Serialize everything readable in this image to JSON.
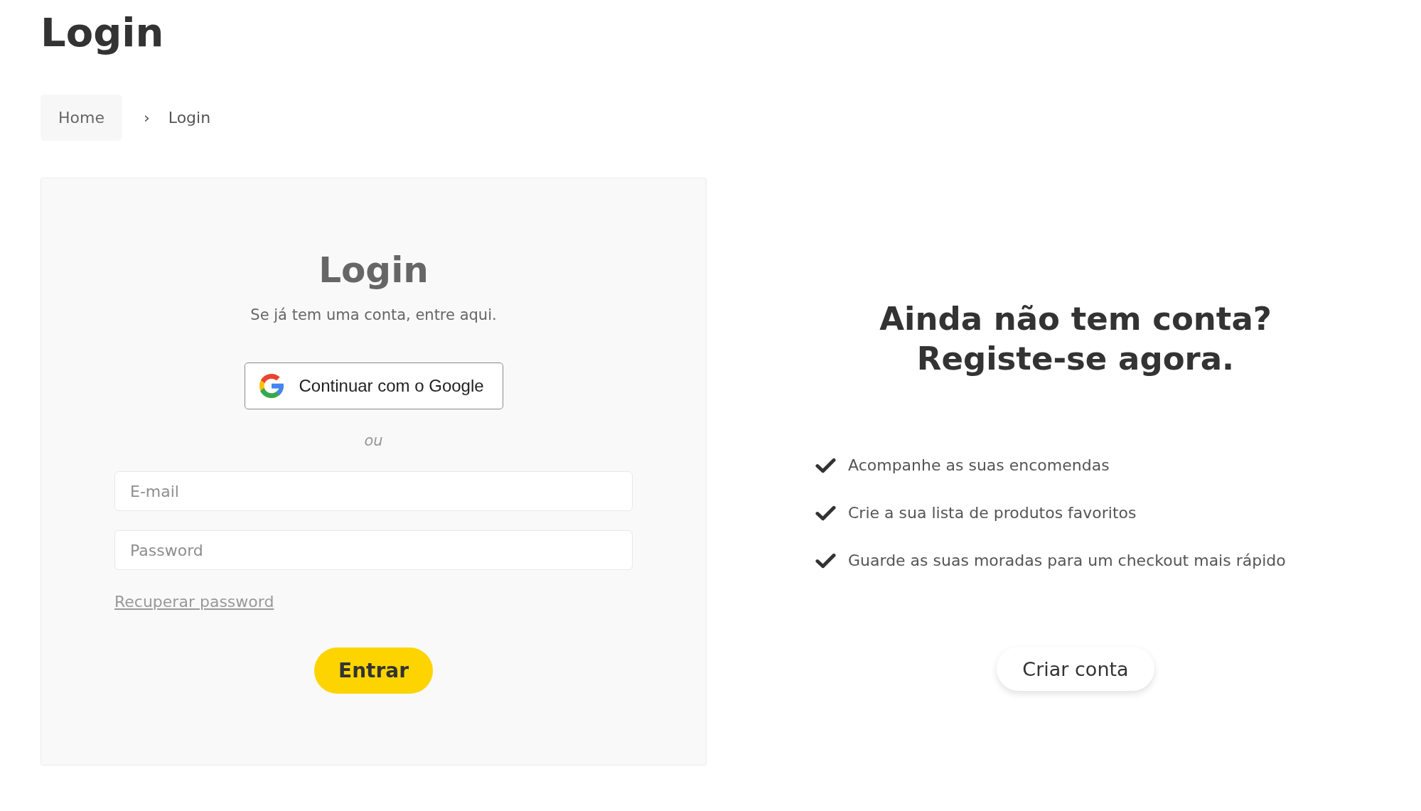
{
  "page_title": "Login",
  "breadcrumb": {
    "items": [
      {
        "label": "Home",
        "kind": "link"
      },
      {
        "label": "Login",
        "kind": "current"
      }
    ],
    "separator": "›"
  },
  "login_panel": {
    "title": "Login",
    "subtitle": "Se já tem uma conta, entre aqui.",
    "google_button": "Continuar com o Google",
    "divider": "ou",
    "fields": [
      {
        "placeholder": "E-mail"
      },
      {
        "placeholder": "Password"
      }
    ],
    "recover_link": "Recuperar password",
    "submit_button": "Entrar"
  },
  "register_panel": {
    "title": "Ainda não tem conta? Registe-se agora.",
    "benefits": [
      {
        "text": "Acompanhe as suas encomendas"
      },
      {
        "text": "Crie a sua lista de produtos favoritos"
      },
      {
        "text": "Guarde as suas moradas para um checkout mais rápido"
      }
    ],
    "create_account_button": "Criar conta"
  }
}
